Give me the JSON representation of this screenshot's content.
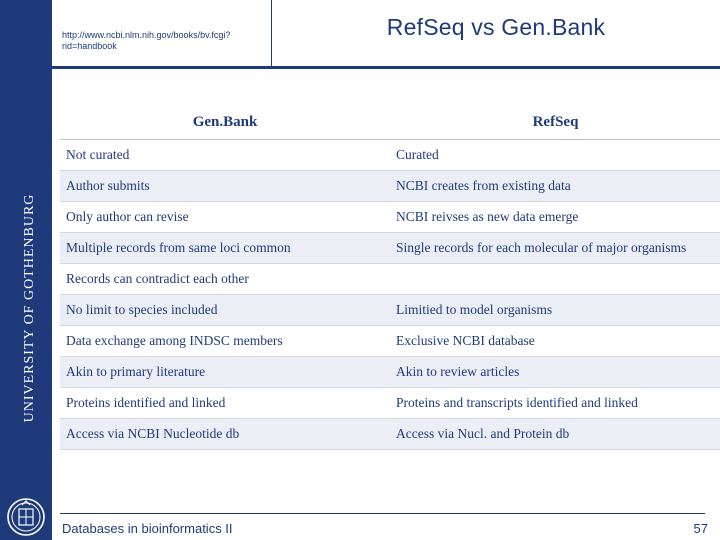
{
  "header": {
    "url": "http://www.ncbi.nlm.nih.gov/books/bv.fcgi?rid=handbook",
    "title": "RefSeq vs Gen.Bank"
  },
  "sidebar": {
    "institution": "UNIVERSITY OF GOTHENBURG",
    "logo_name": "university-seal-logo"
  },
  "table": {
    "columns": [
      "Gen.Bank",
      "RefSeq"
    ],
    "rows": [
      {
        "genbank": "Not curated",
        "refseq": "Curated"
      },
      {
        "genbank": "Author submits",
        "refseq": "NCBI creates from existing data"
      },
      {
        "genbank": "Only author can revise",
        "refseq": "NCBI reivses as new data emerge"
      },
      {
        "genbank": "Multiple records from same loci common",
        "refseq": "Single records for each molecular of major organisms"
      },
      {
        "genbank": "Records can contradict each other",
        "refseq": ""
      },
      {
        "genbank": "No limit to species included",
        "refseq": "Limitied to model organisms"
      },
      {
        "genbank": "Data exchange among INDSC members",
        "refseq": "Exclusive NCBI database"
      },
      {
        "genbank": "Akin to primary literature",
        "refseq": "Akin to review articles"
      },
      {
        "genbank": "Proteins identified and linked",
        "refseq": "Proteins and transcripts identified and linked"
      },
      {
        "genbank": "Access via NCBI Nucleotide db",
        "refseq": "Access via Nucl. and Protein db"
      }
    ]
  },
  "footer": {
    "course": "Databases in bioinformatics II",
    "page": "57"
  },
  "colors": {
    "brand_blue": "#1f3a7a",
    "row_shade": "#eceef5"
  }
}
